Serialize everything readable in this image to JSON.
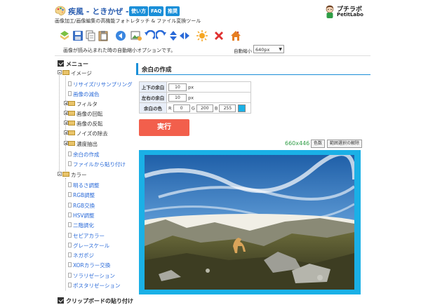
{
  "header": {
    "title": "疾風 - ときかぜ -",
    "subtitle": "画像加工/画像編集の高機能フォトレタッチ & ファイル変換ツール",
    "links": [
      "使い方",
      "FAQ",
      "推奨"
    ],
    "brand_name": "プチラボ",
    "brand_sub": "PetitLabo"
  },
  "toolbar": {
    "icons": [
      "open-icon",
      "save-icon",
      "copy-icon",
      "paste-icon",
      "back-icon",
      "image-settings-icon",
      "rotate-left-icon",
      "rotate-right-icon",
      "flip-vertical-icon",
      "flip-horizontal-icon",
      "sun-icon",
      "delete-icon",
      "home-icon"
    ]
  },
  "notice": {
    "message": "画像が読み込まれた時の自動縮小オプションです。",
    "auto_label": "自動縮小",
    "auto_value": "640px"
  },
  "sidebar": {
    "menu_label": "メニュー",
    "image": {
      "label": "イメージ",
      "items": [
        "リサイズ/リサンプリング",
        "画像の減色"
      ],
      "groups": [
        "フィルタ",
        "画像の回転",
        "画像の反転",
        "ノイズの除去",
        "濃度抽出"
      ],
      "items2": [
        "余白の作成",
        "ファイルから貼り付け"
      ]
    },
    "color": {
      "label": "カラー",
      "items": [
        "明るさ調整",
        "RGB調整",
        "RGB交換",
        "HSV調整",
        "二階調化",
        "セピアカラー",
        "グレースケール",
        "ネガポジ",
        "XORカラー交換",
        "ソラリゼーション",
        "ポスタリゼーション"
      ]
    },
    "clipboard_label": "クリップボードの貼り付け"
  },
  "main": {
    "section_title": "余白の作成",
    "form": {
      "vertical_label": "上下の余白",
      "vertical_value": "10",
      "horizontal_label": "左右の余白",
      "horizontal_value": "10",
      "unit": "px",
      "color_label": "余白の色",
      "r_label": "R",
      "r_value": "0",
      "g_label": "G",
      "g_value": "200",
      "b_label": "B",
      "b_value": "255"
    },
    "run_label": "実行",
    "image_size": "660x446",
    "color_button": "色数",
    "clear_selection_button": "範囲選択の解除"
  },
  "colors": {
    "accent": "#1a8fd8",
    "run_button": "#f25f4c",
    "margin_color": "#00c8ff",
    "link": "#2a6ad8"
  }
}
